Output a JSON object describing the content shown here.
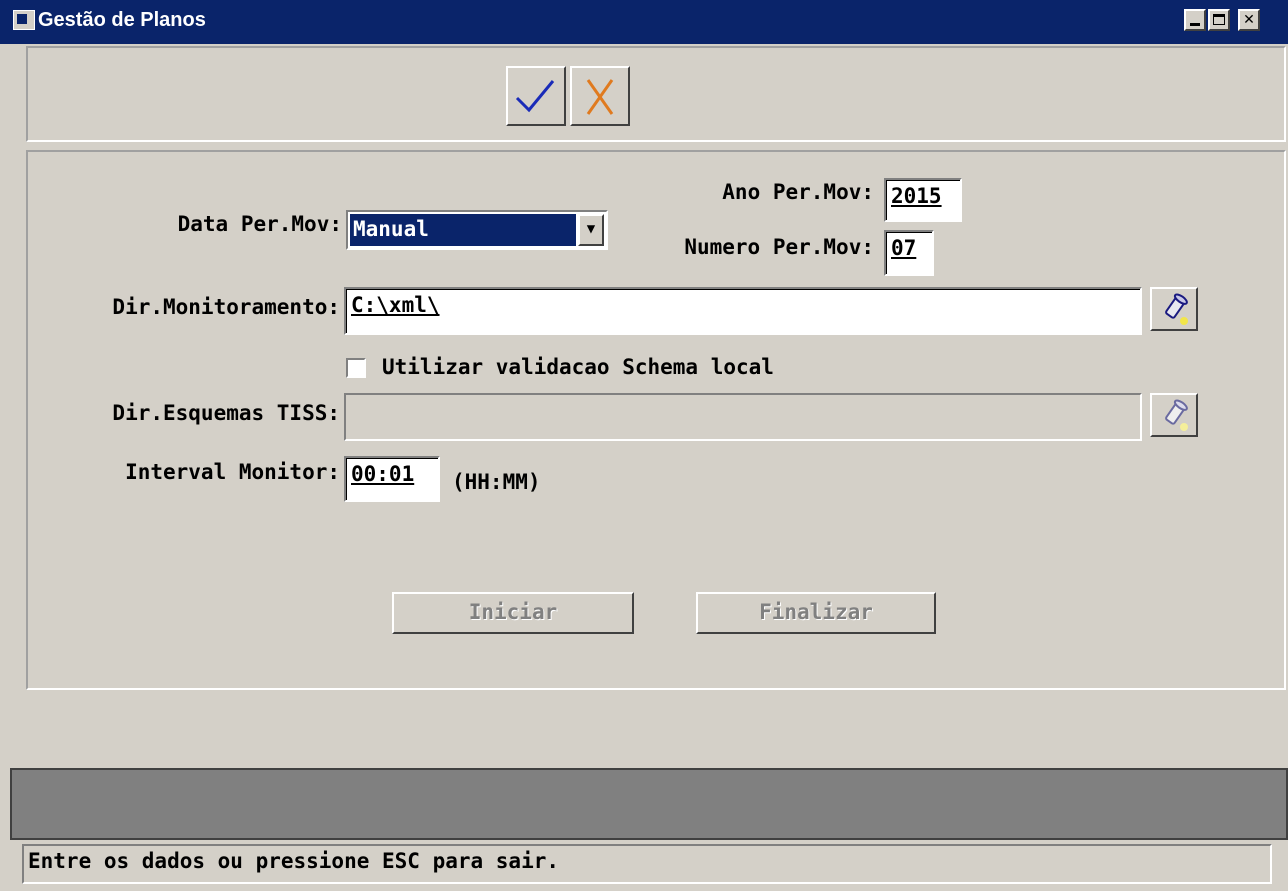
{
  "window": {
    "title": "Gestão de Planos",
    "accent": "#0a246a"
  },
  "toolbar": {
    "confirm_icon": "checkmark-icon",
    "cancel_icon": "x-icon",
    "confirm_color": "#1a2bb8",
    "cancel_color": "#e07a1e"
  },
  "form": {
    "ano_label": "Ano Per.Mov:",
    "ano_value": "2015",
    "data_label": "Data Per.Mov:",
    "data_value": "Manual",
    "numero_label": "Numero Per.Mov:",
    "numero_value": "07",
    "dir_monit_label": "Dir.Monitoramento:",
    "dir_monit_value": "C:\\xml\\",
    "schema_checkbox_label": "Utilizar validacao Schema local",
    "schema_checked": false,
    "dir_esquemas_label": "Dir.Esquemas TISS:",
    "dir_esquemas_value": "",
    "interval_label": "Interval Monitor:",
    "interval_value": "00:01",
    "interval_unit": "(HH:MM)"
  },
  "buttons": {
    "iniciar": "Iniciar",
    "finalizar": "Finalizar"
  },
  "status": {
    "message": "Entre os dados ou pressione ESC para sair."
  }
}
